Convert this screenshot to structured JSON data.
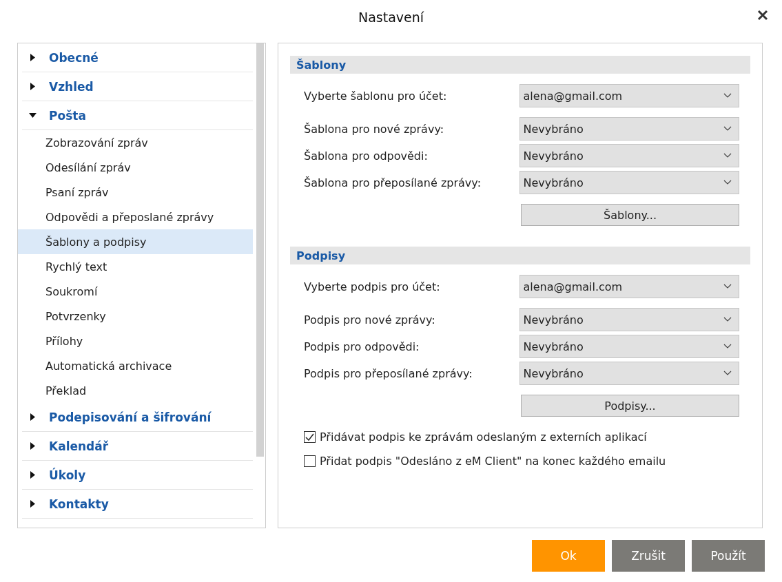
{
  "window": {
    "title": "Nastavení"
  },
  "sidebar": {
    "items": [
      {
        "label": "Obecné",
        "expanded": false
      },
      {
        "label": "Vzhled",
        "expanded": false
      },
      {
        "label": "Pošta",
        "expanded": true,
        "children": [
          {
            "label": "Zobrazování zpráv",
            "selected": false
          },
          {
            "label": "Odesílání zpráv",
            "selected": false
          },
          {
            "label": "Psaní zpráv",
            "selected": false
          },
          {
            "label": "Odpovědi a přeposlané zprávy",
            "selected": false
          },
          {
            "label": "Šablony a podpisy",
            "selected": true
          },
          {
            "label": "Rychlý text",
            "selected": false
          },
          {
            "label": "Soukromí",
            "selected": false
          },
          {
            "label": "Potvrzenky",
            "selected": false
          },
          {
            "label": "Přílohy",
            "selected": false
          },
          {
            "label": "Automatická archivace",
            "selected": false
          },
          {
            "label": "Překlad",
            "selected": false
          }
        ]
      },
      {
        "label": "Podepisování a šifrování",
        "expanded": false
      },
      {
        "label": "Kalendář",
        "expanded": false
      },
      {
        "label": "Úkoly",
        "expanded": false
      },
      {
        "label": "Kontakty",
        "expanded": false
      }
    ]
  },
  "sections": [
    {
      "title": "Šablony",
      "fields": [
        {
          "label": "Vyberte šablonu pro účet:",
          "value": "alena@gmail.com"
        },
        {
          "label": "Šablona pro nové zprávy:",
          "value": "Nevybráno"
        },
        {
          "label": "Šablona pro odpovědi:",
          "value": "Nevybráno"
        },
        {
          "label": "Šablona pro přeposílané zprávy:",
          "value": "Nevybráno"
        }
      ],
      "button": "Šablony..."
    },
    {
      "title": "Podpisy",
      "fields": [
        {
          "label": "Vyberte podpis pro účet:",
          "value": "alena@gmail.com"
        },
        {
          "label": "Podpis pro nové zprávy:",
          "value": "Nevybráno"
        },
        {
          "label": "Podpis pro odpovědi:",
          "value": "Nevybráno"
        },
        {
          "label": "Podpis pro přeposílané zprávy:",
          "value": "Nevybráno"
        }
      ],
      "button": "Podpisy..."
    }
  ],
  "checkboxes": [
    {
      "label": "Přidávat podpis ke zprávám odeslaným z externích aplikací",
      "checked": true
    },
    {
      "label": "Přidat podpis \"Odesláno z eM Client\" na konec každého emailu",
      "checked": false
    }
  ],
  "buttons": [
    {
      "label": "Ok",
      "kind": "primary"
    },
    {
      "label": "Zrušit",
      "kind": "secondary"
    },
    {
      "label": "Použít",
      "kind": "secondary"
    }
  ]
}
